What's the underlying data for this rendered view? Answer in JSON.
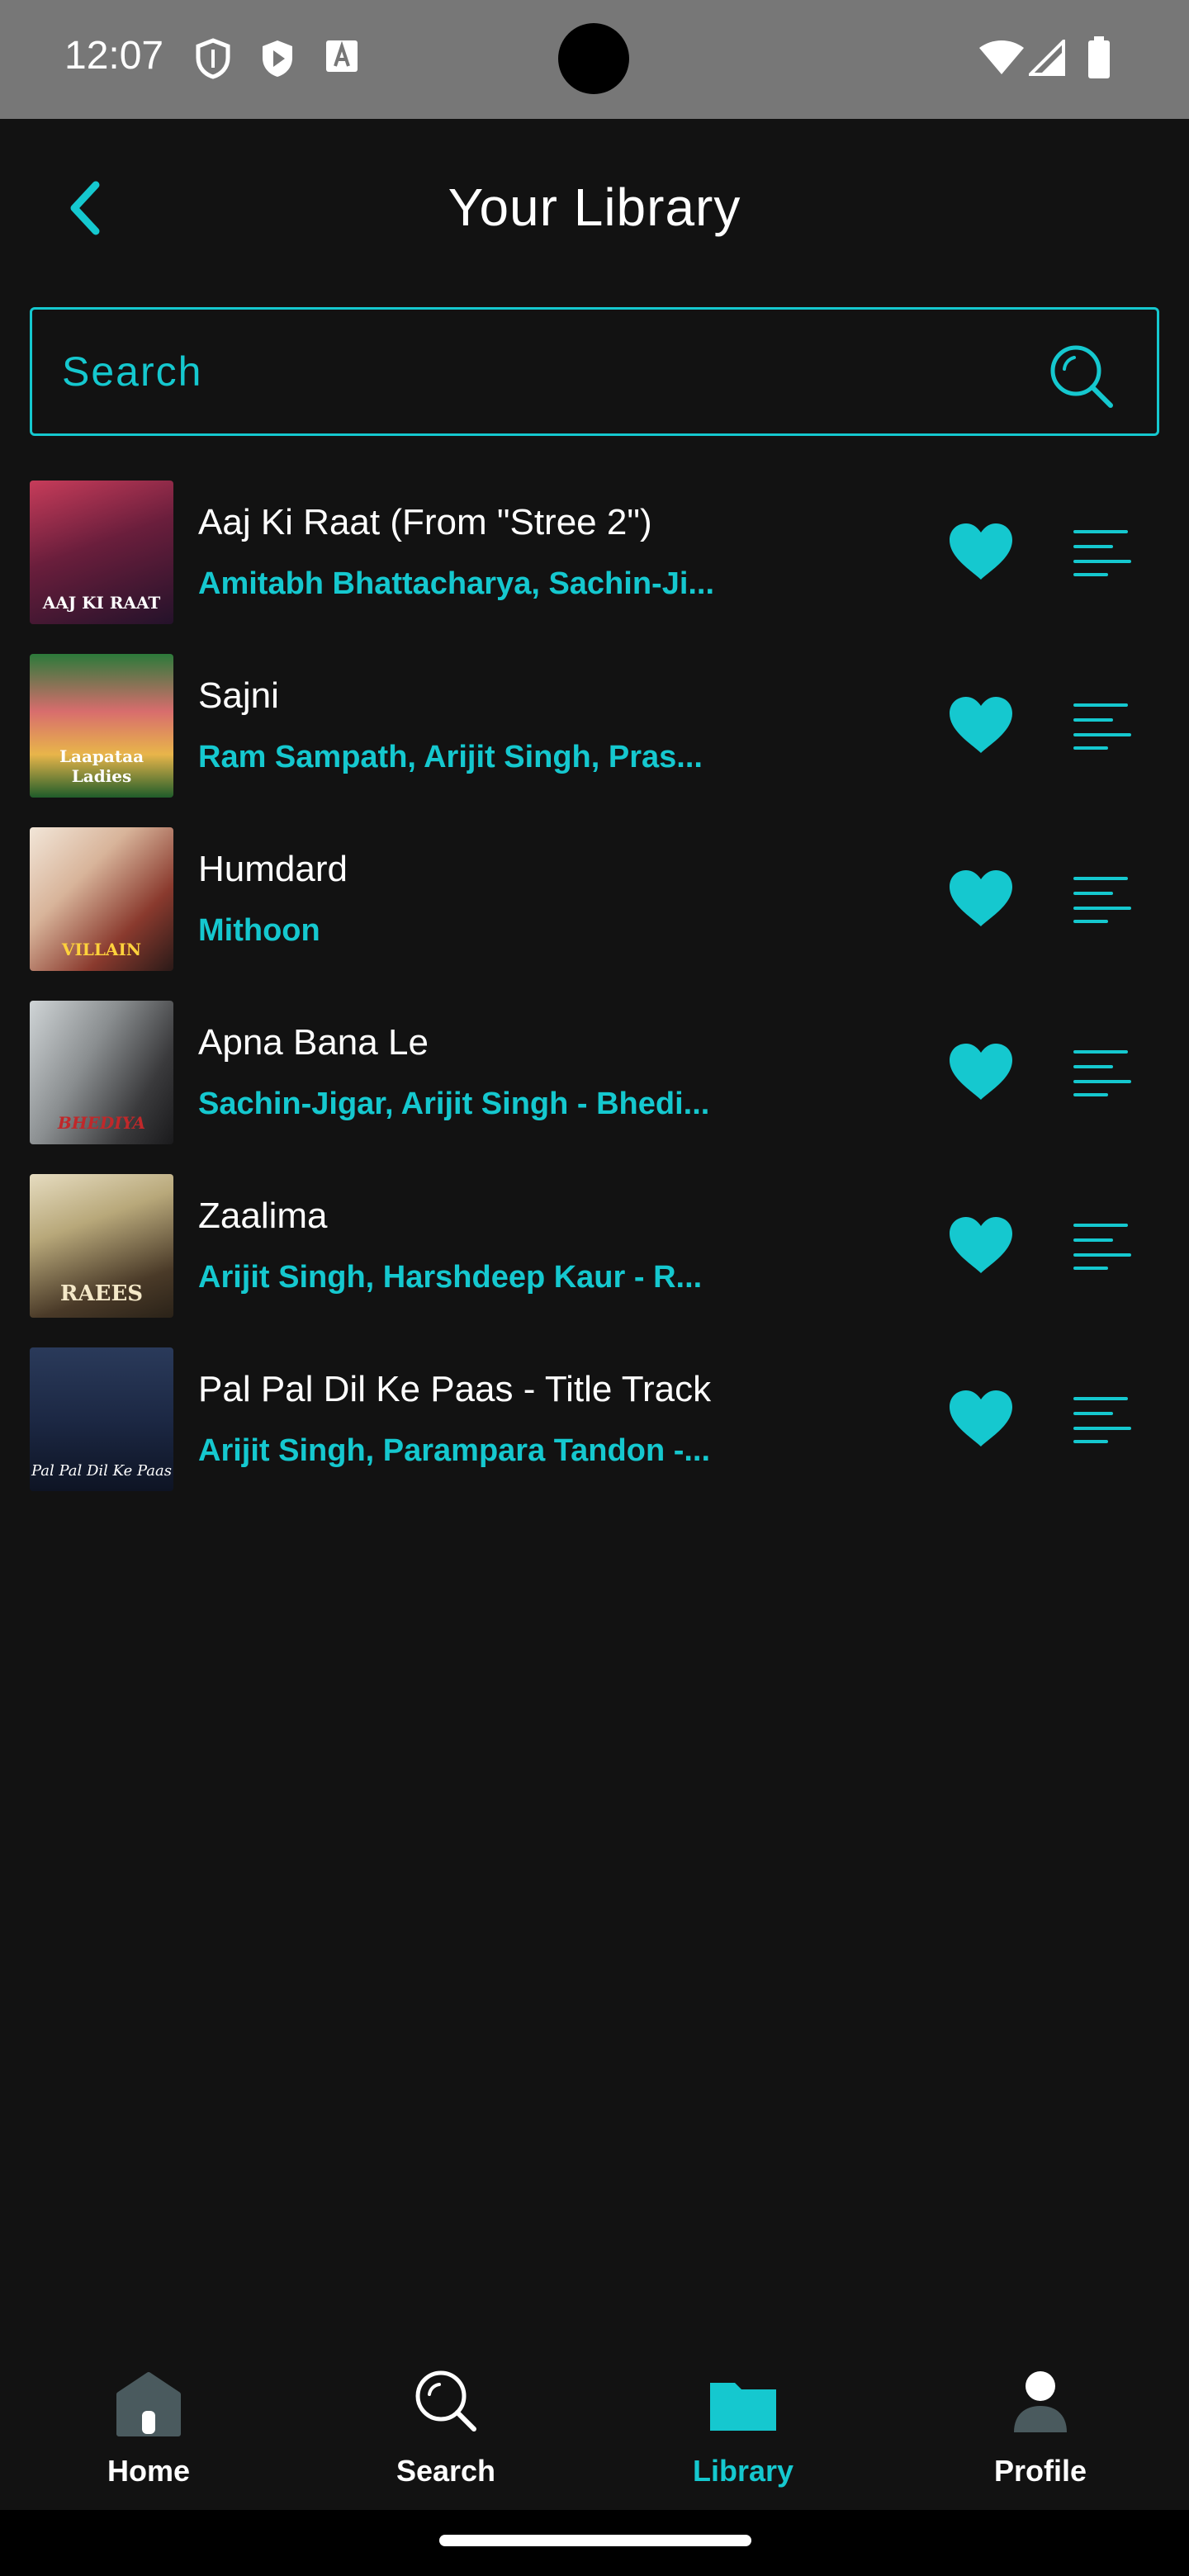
{
  "status_bar": {
    "time": "12:07",
    "icons": [
      "shield-icon",
      "play-protect-icon",
      "font-icon",
      "wifi-icon",
      "signal-icon",
      "battery-icon"
    ]
  },
  "header": {
    "title": "Your Library",
    "back_icon": "chevron-left-icon"
  },
  "search": {
    "placeholder": "Search",
    "value": ""
  },
  "colors": {
    "accent": "#15c8cf",
    "background": "#121212",
    "status_bar": "#777777"
  },
  "songs": [
    {
      "title": "Aaj Ki Raat (From \"Stree 2\")",
      "artist": "Amitabh Bhattacharya, Sachin-Ji...",
      "cover_text": "AAJ KI RAAT",
      "liked": true
    },
    {
      "title": "Sajni",
      "artist": "Ram Sampath, Arijit Singh, Pras...",
      "cover_text": "Laapataa Ladies",
      "liked": true
    },
    {
      "title": "Humdard",
      "artist": "Mithoon",
      "cover_text": "VILLAIN",
      "liked": true
    },
    {
      "title": "Apna Bana Le",
      "artist": "Sachin-Jigar, Arijit Singh - Bhedi...",
      "cover_text": "BHEDIYA",
      "liked": true
    },
    {
      "title": "Zaalima",
      "artist": "Arijit Singh, Harshdeep Kaur - R...",
      "cover_text": "RAEES",
      "liked": true
    },
    {
      "title": "Pal Pal Dil Ke Paas - Title Track",
      "artist": "Arijit Singh, Parampara Tandon -...",
      "cover_text": "Pal Pal Dil Ke Paas",
      "liked": true
    }
  ],
  "bottom_nav": {
    "items": [
      {
        "label": "Home",
        "icon": "home-icon",
        "active": false
      },
      {
        "label": "Search",
        "icon": "search-icon",
        "active": false
      },
      {
        "label": "Library",
        "icon": "folder-icon",
        "active": true
      },
      {
        "label": "Profile",
        "icon": "profile-icon",
        "active": false
      }
    ]
  }
}
